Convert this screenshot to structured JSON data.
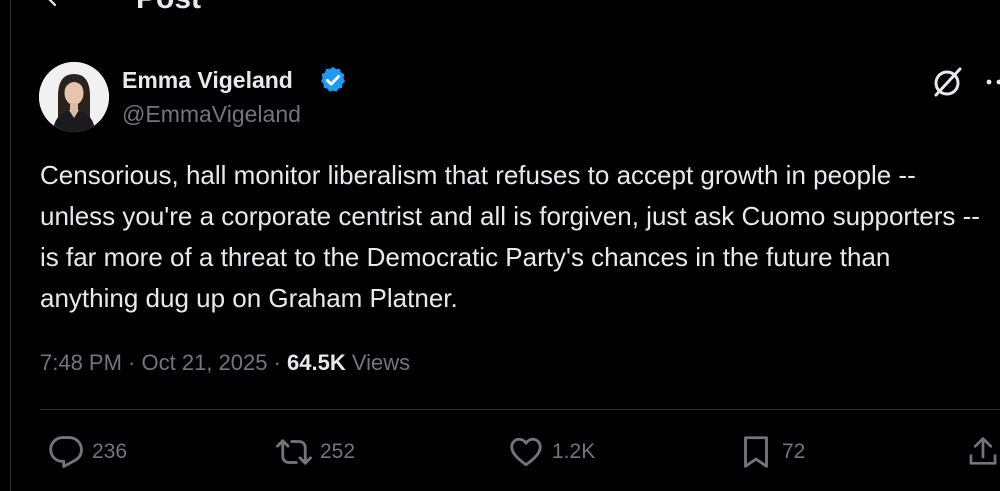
{
  "header": {
    "title": "Post"
  },
  "post": {
    "author": {
      "name": "Emma Vigeland",
      "handle": "@EmmaVigeland",
      "verified": true
    },
    "text": "Censorious, hall monitor liberalism that refuses to accept growth in people -- unless you're a corporate centrist and all is forgiven, just ask Cuomo supporters -- is far more of a threat to the Democratic Party's chances in the future than anything dug up on Graham Platner.",
    "time": "7:48 PM",
    "date": "Oct 21, 2025",
    "views_count": "64.5K",
    "views_label": "Views",
    "separator": " · "
  },
  "actions": {
    "replies": "236",
    "reposts": "252",
    "likes": "1.2K",
    "bookmarks": "72"
  },
  "colors": {
    "background": "#000000",
    "text_primary": "#e7e9ea",
    "text_secondary": "#71767b",
    "divider": "#2f3336",
    "verified": "#1d9bf0"
  },
  "icons": {
    "back": "back-arrow-icon",
    "verified": "verified-badge-icon",
    "grok": "grok-icon",
    "more": "more-icon",
    "reply": "reply-icon",
    "repost": "repost-icon",
    "like": "like-icon",
    "bookmark": "bookmark-icon",
    "share": "share-icon"
  }
}
